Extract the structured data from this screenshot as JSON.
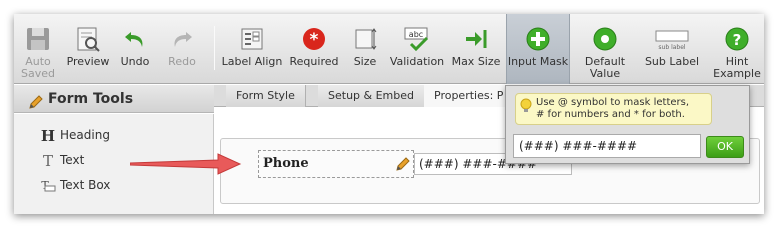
{
  "toolbar": {
    "buttons": [
      {
        "label1": "Auto",
        "label2": "Saved",
        "icon": "floppy-disk-icon",
        "disabled": true
      },
      {
        "label1": "Preview",
        "label2": "",
        "icon": "preview-icon"
      },
      {
        "label1": "Undo",
        "label2": "",
        "icon": "undo-icon"
      },
      {
        "label1": "Redo",
        "label2": "",
        "icon": "redo-icon",
        "disabled": true
      },
      {
        "label1": "Label Align",
        "label2": "",
        "icon": "label-align-icon"
      },
      {
        "label1": "Required",
        "label2": "",
        "icon": "required-icon"
      },
      {
        "label1": "Size",
        "label2": "",
        "icon": "size-icon"
      },
      {
        "label1": "Validation",
        "label2": "",
        "icon": "validation-icon"
      },
      {
        "label1": "Max Size",
        "label2": "",
        "icon": "max-size-icon"
      },
      {
        "label1": "Input Mask",
        "label2": "",
        "icon": "input-mask-icon",
        "active": true
      },
      {
        "label1": "Default",
        "label2": "Value",
        "icon": "default-value-icon"
      },
      {
        "label1": "Sub Label",
        "label2": "",
        "icon": "sub-label-icon"
      },
      {
        "label1": "Hint",
        "label2": "Example",
        "icon": "hint-icon"
      }
    ],
    "abc_text": "abc",
    "sublabel_text": "sub label"
  },
  "sidebar": {
    "title": "Form Tools",
    "items": [
      {
        "label": "Heading",
        "icon": "heading-icon"
      },
      {
        "label": "Text",
        "icon": "text-icon"
      },
      {
        "label": "Text Box",
        "icon": "textbox-icon"
      }
    ]
  },
  "tabs": [
    {
      "label": "Form Style"
    },
    {
      "label": "Setup & Embed"
    },
    {
      "label": "Properties: P"
    }
  ],
  "field": {
    "label": "Phone",
    "value": "(###) ###-####"
  },
  "popup": {
    "hint_line1": "Use @ symbol to mask letters,",
    "hint_line2": "# for numbers and * for both.",
    "mask_value": "(###) ###-####",
    "ok_label": "OK"
  },
  "colors": {
    "ok_green": "#4caf22",
    "required_red": "#d9261c",
    "arrow_red": "#e85a5a",
    "hint_yellow": "#fbf8c6"
  }
}
